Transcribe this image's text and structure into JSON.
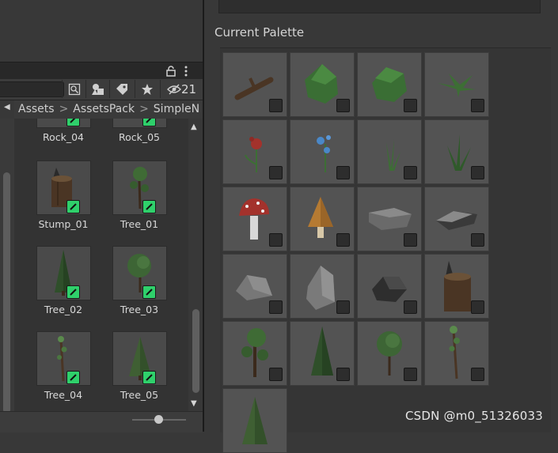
{
  "left_panel": {
    "toolbar": {
      "hidden_count": "21"
    },
    "breadcrumb": [
      "Assets",
      "AssetsPack",
      "SimpleN"
    ],
    "assets": [
      {
        "label": "Rock_04"
      },
      {
        "label": "Rock_05"
      },
      {
        "label": "Stump_01"
      },
      {
        "label": "Tree_01"
      },
      {
        "label": "Tree_02"
      },
      {
        "label": "Tree_03"
      },
      {
        "label": "Tree_04"
      },
      {
        "label": "Tree_05"
      }
    ],
    "icons": {
      "lock": "lock-icon",
      "menu": "kebab-menu-icon",
      "search_box": "search-box-icon",
      "type_filter": "shapes-filter-icon",
      "label_filter": "label-tag-icon",
      "favorite_filter": "star-icon",
      "hidden_toggle": "eye-slash-icon",
      "breadcrumb_back": "triangle-left-icon",
      "scroll_up": "triangle-up-icon",
      "scroll_down": "triangle-down-icon",
      "badge": "pencil-badge-icon"
    },
    "badge_color": "#2fd06b"
  },
  "palette": {
    "title": "Current Palette",
    "items": [
      "Log",
      "Bush_01",
      "Bush_02",
      "Fern",
      "Flower_Red",
      "Flower_Blue",
      "Grass_01",
      "Grass_02",
      "Mushroom_Red",
      "Mushroom_Brown",
      "Rock_01",
      "Rock_02",
      "Rock_03",
      "Rock_04",
      "Rock_05",
      "Stump_01",
      "Tree_01",
      "Tree_02",
      "Tree_03",
      "Tree_04",
      "Tree_05"
    ]
  },
  "watermark": "CSDN @m0_51326033"
}
